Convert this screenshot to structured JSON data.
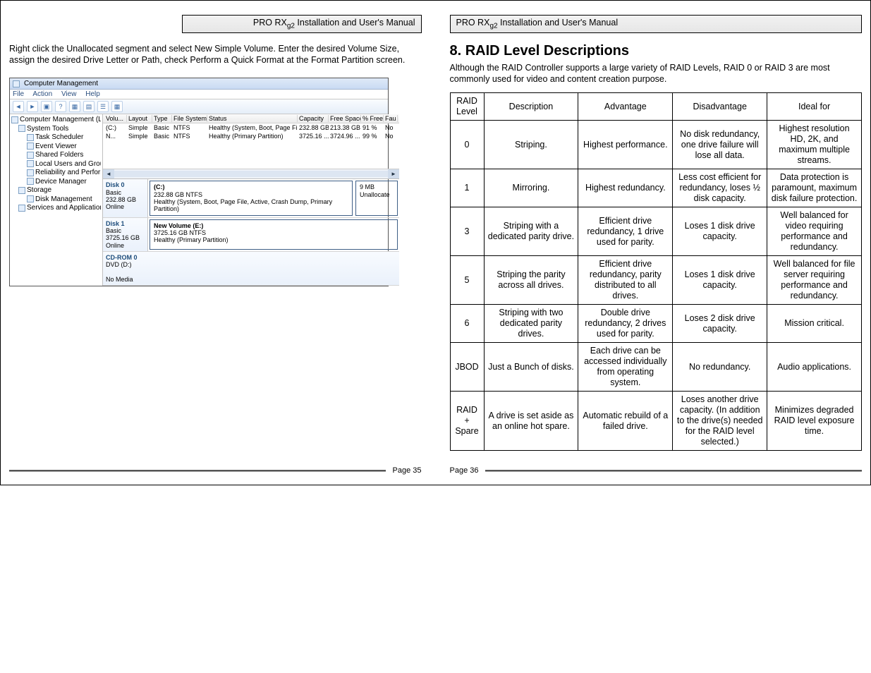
{
  "header_title_prefix": "PRO RX",
  "header_title_sub": "g2",
  "header_title_suffix": " Installation and User's Manual",
  "left_body": "Right click the Unallocated segment and select New Simple Volume.  Enter the desired Volume Size, assign the desired Drive Letter or Path, check Perform a Quick Format at the Format Partition screen.",
  "scr": {
    "title": "Computer Management",
    "menus": [
      "File",
      "Action",
      "View",
      "Help"
    ],
    "tree": {
      "root": "Computer Management (Local",
      "system_tools": "System Tools",
      "items_st": [
        "Task Scheduler",
        "Event Viewer",
        "Shared Folders",
        "Local Users and Groups",
        "Reliability and Performa",
        "Device Manager"
      ],
      "storage": "Storage",
      "disk_mgmt": "Disk Management",
      "services": "Services and Applications"
    },
    "vol_headers": [
      "Volu...",
      "Layout",
      "Type",
      "File System",
      "Status",
      "Capacity",
      "Free Space",
      "% Free",
      "Fau"
    ],
    "vol_rows": [
      {
        "v": "(C:)",
        "layout": "Simple",
        "type": "Basic",
        "fs": "NTFS",
        "status": "Healthy (System, Boot, Page File, Ac...",
        "cap": "232.88 GB",
        "free": "213.38 GB",
        "pct": "91 %",
        "fault": "No"
      },
      {
        "v": "N...",
        "layout": "Simple",
        "type": "Basic",
        "fs": "NTFS",
        "status": "Healthy (Primary Partition)",
        "cap": "3725.16 ...",
        "free": "3724.96 ...",
        "pct": "99 %",
        "fault": "No"
      }
    ],
    "disks": {
      "d0": {
        "label": "Disk 0",
        "kind": "Basic",
        "size": "232.88 GB",
        "state": "Online",
        "p": {
          "title": "(C:)",
          "line1": "232.88 GB NTFS",
          "line2": "Healthy (System, Boot, Page File, Active, Crash Dump, Primary Partition)"
        },
        "p2": {
          "title": "",
          "line1": "9 MB",
          "line2": "Unallocate"
        }
      },
      "d1": {
        "label": "Disk 1",
        "kind": "Basic",
        "size": "3725.16 GB",
        "state": "Online",
        "p": {
          "title": "New Volume  (E:)",
          "line1": "3725.16 GB NTFS",
          "line2": "Healthy (Primary Partition)"
        }
      },
      "cd": {
        "label": "CD-ROM 0",
        "sub": "DVD (D:)",
        "state": "No Media"
      }
    }
  },
  "raid": {
    "heading": "8. RAID Level Descriptions",
    "intro": "Although the RAID Controller supports a large variety of RAID Levels, RAID 0 or RAID 3 are most commonly used for video and content creation purpose.",
    "headers": [
      "RAID Level",
      "Description",
      "Advantage",
      "Disadvantage",
      "Ideal for"
    ],
    "rows": [
      {
        "level": "0",
        "desc": "Striping.",
        "adv": "Highest performance.",
        "dis": "No disk redundancy, one drive failure will lose all data.",
        "ideal": "Highest resolution HD, 2K, and maximum multiple streams."
      },
      {
        "level": "1",
        "desc": "Mirroring.",
        "adv": "Highest redundancy.",
        "dis": "Less cost efficient for redundancy, loses ½ disk capacity.",
        "ideal": "Data protection is paramount, maximum disk failure protection."
      },
      {
        "level": "3",
        "desc": "Striping with a dedicated parity drive.",
        "adv": "Efficient drive redundancy, 1 drive used for parity.",
        "dis": "Loses 1 disk drive capacity.",
        "ideal": "Well balanced for video requiring performance and redundancy."
      },
      {
        "level": "5",
        "desc": "Striping the parity across all drives.",
        "adv": "Efficient drive redundancy, parity distributed to all drives.",
        "dis": "Loses 1 disk drive capacity.",
        "ideal": "Well balanced for file server requiring performance and redundancy."
      },
      {
        "level": "6",
        "desc": "Striping with two dedicated parity drives.",
        "adv": "Double drive redundancy, 2 drives used for parity.",
        "dis": "Loses 2 disk drive capacity.",
        "ideal": "Mission critical."
      },
      {
        "level": "JBOD",
        "desc": "Just a Bunch of disks.",
        "adv": "Each drive can be accessed individually from operating system.",
        "dis": "No redundancy.",
        "ideal": "Audio applications."
      },
      {
        "level": "RAID + Spare",
        "desc": "A drive is set aside as an online hot spare.",
        "adv": "Automatic rebuild of a failed drive.",
        "dis": "Loses another drive capacity.  (In addition to the drive(s) needed for the RAID level selected.)",
        "ideal": "Minimizes degraded RAID level exposure time."
      }
    ]
  },
  "page_left": "Page 35",
  "page_right": "Page 36"
}
